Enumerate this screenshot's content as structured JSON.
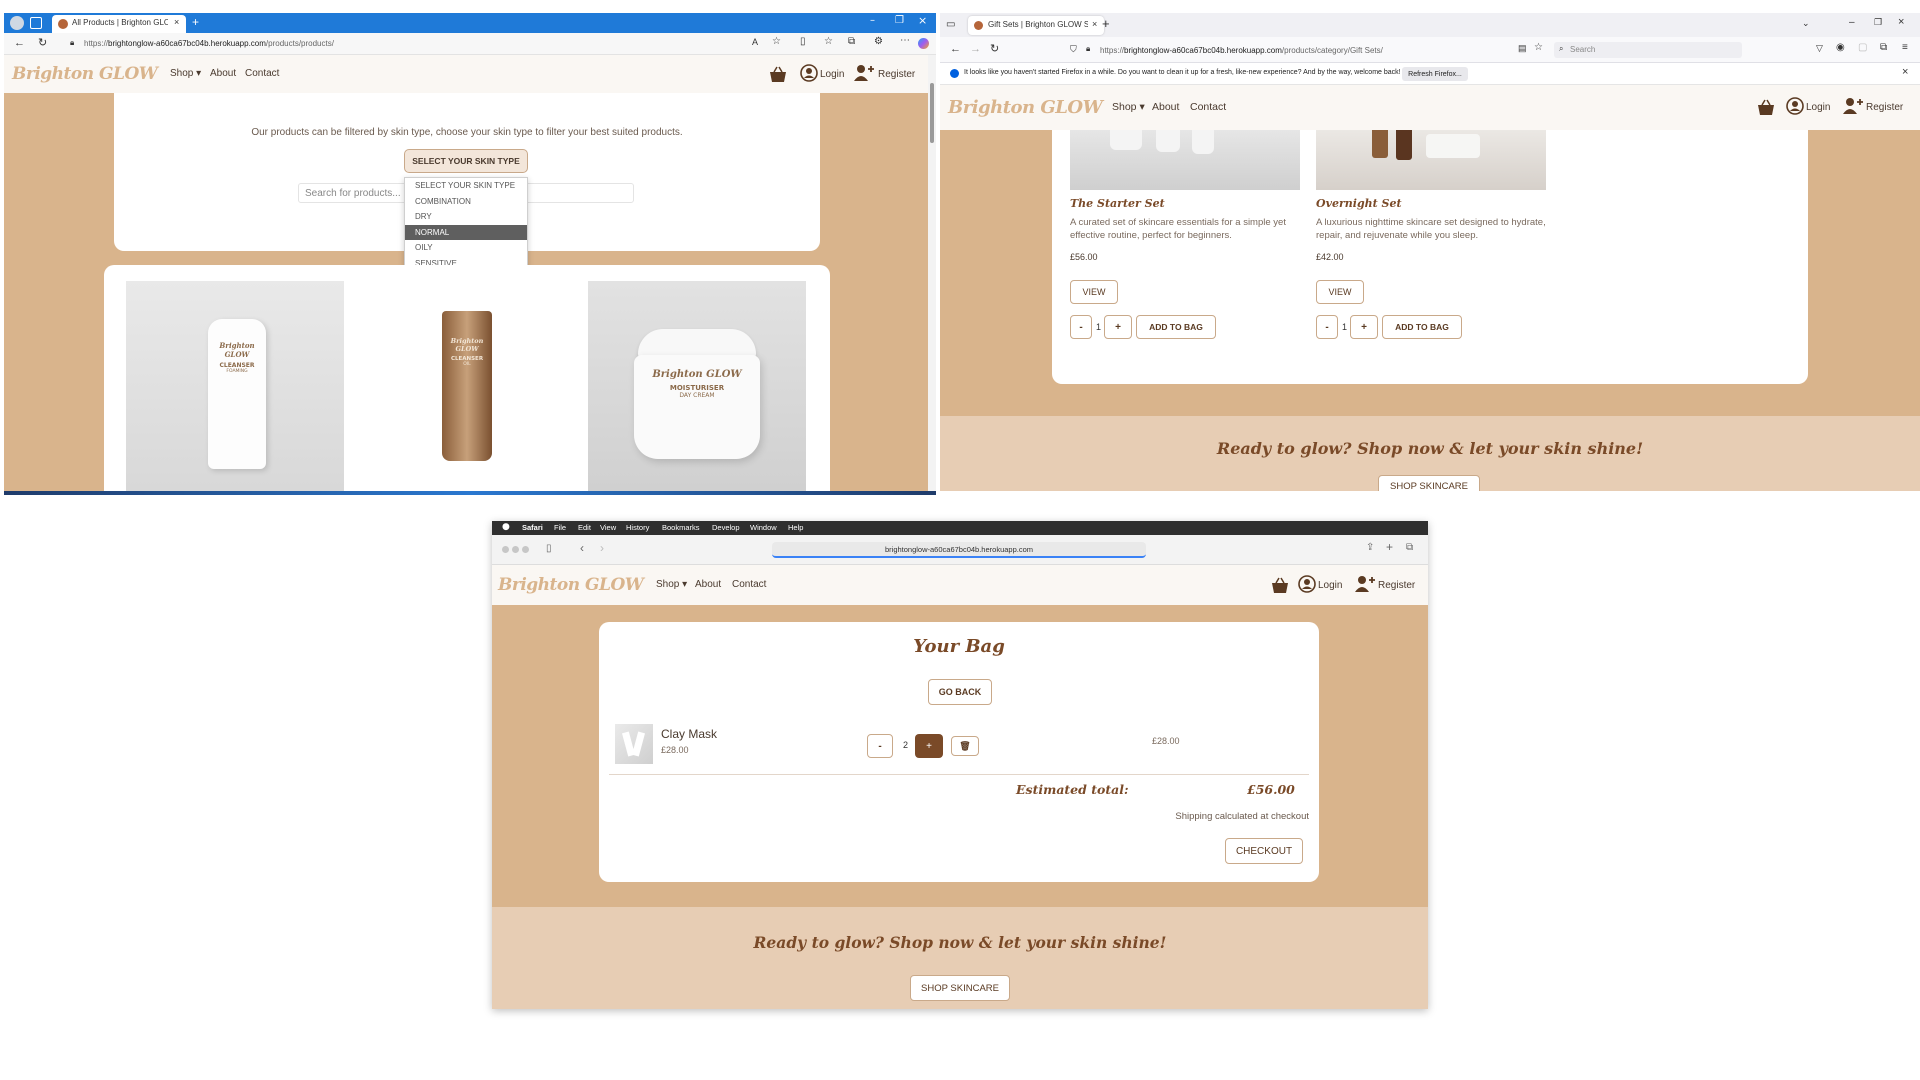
{
  "win1": {
    "tab_title": "All Products | Brighton GLOW Sk",
    "url_prefix": "https://",
    "url_host": "brightonglow-a60ca67bc04b.herokuapp.com",
    "url_path": "/products/products/",
    "logo": "Brighton GLOW",
    "nav": {
      "shop": "Shop",
      "about": "About",
      "contact": "Contact",
      "login": "Login",
      "register": "Register"
    },
    "intro": "Our products can be filtered by skin type, choose your skin type to filter your best suited products.",
    "select_label": "SELECT YOUR SKIN TYPE",
    "options": [
      "SELECT YOUR SKIN TYPE",
      "COMBINATION",
      "DRY",
      "NORMAL",
      "OILY",
      "SENSITIVE"
    ],
    "selected_option": "NORMAL",
    "search_placeholder": "Search for products...",
    "products": [
      {
        "brand": "Brighton GLOW",
        "name": "CLEANSER",
        "sub": "FOAMING"
      },
      {
        "brand": "Brighton GLOW",
        "name": "CLEANSER",
        "sub": "OIL"
      },
      {
        "brand": "Brighton GLOW",
        "name": "MOISTURISER",
        "sub": "DAY CREAM"
      }
    ]
  },
  "win2": {
    "tab_title": "Gift Sets | Brighton GLOW Skin",
    "url_prefix": "https://",
    "url_host": "brightonglow-a60ca67bc04b.herokuapp.com",
    "url_path": "/products/category/Gift Sets/",
    "search_placeholder": "Search",
    "notice": "It looks like you haven't started Firefox in a while. Do you want to clean it up for a fresh, like-new experience? And by the way, welcome back!",
    "refresh_button": "Refresh Firefox...",
    "logo": "Brighton GLOW",
    "nav": {
      "shop": "Shop",
      "about": "About",
      "contact": "Contact",
      "login": "Login",
      "register": "Register"
    },
    "products": [
      {
        "name": "The Starter Set",
        "desc": "A curated set of skincare essentials for a simple yet effective routine, perfect for beginners.",
        "price": "£56.00",
        "qty": "1"
      },
      {
        "name": "Overnight Set",
        "desc": "A luxurious nighttime skincare set designed to hydrate, repair, and rejuvenate while you sleep.",
        "price": "£42.00",
        "qty": "1"
      }
    ],
    "view_label": "VIEW",
    "add_label": "ADD TO BAG",
    "minus": "-",
    "plus": "+",
    "cta": "Ready to glow? Shop now & let your skin shine!",
    "cta_button": "SHOP SKINCARE"
  },
  "win3": {
    "menubar": [
      "Safari",
      "File",
      "Edit",
      "View",
      "History",
      "Bookmarks",
      "Develop",
      "Window",
      "Help"
    ],
    "url": "brightonglow-a60ca67bc04b.herokuapp.com",
    "logo": "Brighton GLOW",
    "nav": {
      "shop": "Shop",
      "about": "About",
      "contact": "Contact",
      "login": "Login",
      "register": "Register"
    },
    "bag_title": "Your Bag",
    "go_back": "GO BACK",
    "item": {
      "name": "Clay Mask",
      "price": "£28.00",
      "qty": "2",
      "subtotal": "£28.00"
    },
    "minus": "-",
    "plus": "+",
    "total_label": "Estimated total:",
    "total_value": "£56.00",
    "shipping": "Shipping calculated at checkout",
    "checkout": "CHECKOUT",
    "cta": "Ready to glow? Shop now & let your skin shine!",
    "cta_button": "SHOP SKINCARE"
  },
  "colors": {
    "tan": "#d9b48c",
    "brown": "#7a4a28",
    "light_tan": "#e7cdb4",
    "edge_blue": "#0078d4"
  }
}
